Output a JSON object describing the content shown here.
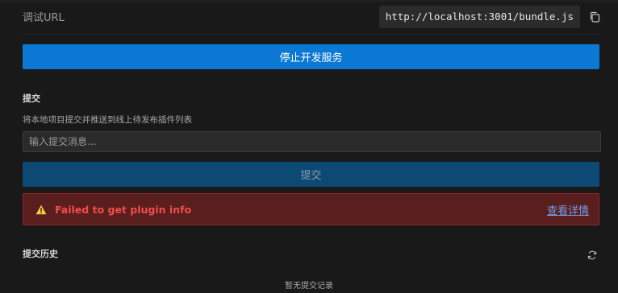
{
  "debug": {
    "label": "调试URL",
    "url": "http://localhost:3001/bundle.js"
  },
  "dev_server": {
    "stop_label": "停止开发服务"
  },
  "commit": {
    "title": "提交",
    "description": "将本地项目提交并推送到线上待发布插件列表",
    "placeholder": "输入提交消息...",
    "button_label": "提交"
  },
  "error": {
    "message": "Failed to get plugin info",
    "link_label": "查看详情"
  },
  "history": {
    "title": "提交历史",
    "empty_text": "暂无提交记录"
  },
  "colors": {
    "primary": "#0b78d4",
    "primary_disabled": "#0c4a75",
    "error_bg": "#5a1e1e",
    "error_text": "#f14c4c",
    "link": "#6f9fe8",
    "warning": "#f0d13a"
  },
  "icons": {
    "copy": "copy-icon",
    "warning": "warning-icon",
    "refresh": "refresh-icon"
  }
}
